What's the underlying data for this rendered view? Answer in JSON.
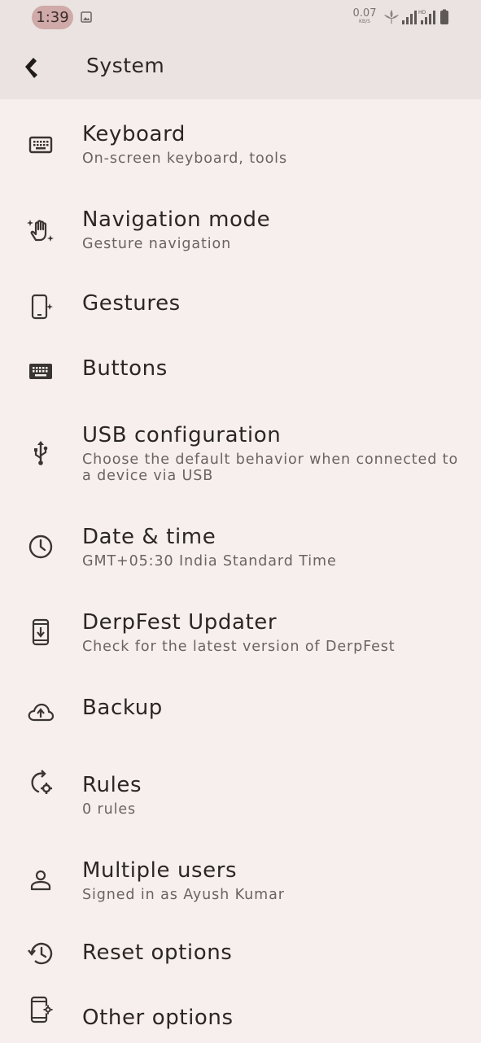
{
  "status_bar": {
    "time": "1:39",
    "net_speed_value": "0.07",
    "net_speed_unit": "KB/S",
    "icons": [
      "image-icon",
      "leaf-icon",
      "signal-icon",
      "hd-signal-icon",
      "battery-icon"
    ]
  },
  "app_bar": {
    "title": "System",
    "back_icon": "back-arrow-icon"
  },
  "items": [
    {
      "title": "Keyboard",
      "subtitle": "On-screen keyboard, tools",
      "icon": "keyboard-icon"
    },
    {
      "title": "Navigation mode",
      "subtitle": "Gesture navigation",
      "icon": "gesture-hand-icon"
    },
    {
      "title": "Gestures",
      "subtitle": "",
      "icon": "phone-sparkle-icon"
    },
    {
      "title": "Buttons",
      "subtitle": "",
      "icon": "keyboard-filled-icon"
    },
    {
      "title": "USB configuration",
      "subtitle": "Choose the default behavior when connected to a device via USB",
      "icon": "usb-icon"
    },
    {
      "title": "Date & time",
      "subtitle": "GMT+05:30 India Standard Time",
      "icon": "clock-icon"
    },
    {
      "title": "DerpFest Updater",
      "subtitle": "Check for the latest version of DerpFest",
      "icon": "system-update-icon"
    },
    {
      "title": "Backup",
      "subtitle": "",
      "icon": "cloud-upload-icon"
    },
    {
      "title": "Rules",
      "subtitle": "0 rules",
      "icon": "rules-sync-icon"
    },
    {
      "title": "Multiple users",
      "subtitle": "Signed in as Ayush Kumar",
      "icon": "person-icon"
    },
    {
      "title": "Reset options",
      "subtitle": "",
      "icon": "history-icon"
    },
    {
      "title": "Other options",
      "subtitle": "",
      "icon": "phone-settings-icon"
    }
  ]
}
